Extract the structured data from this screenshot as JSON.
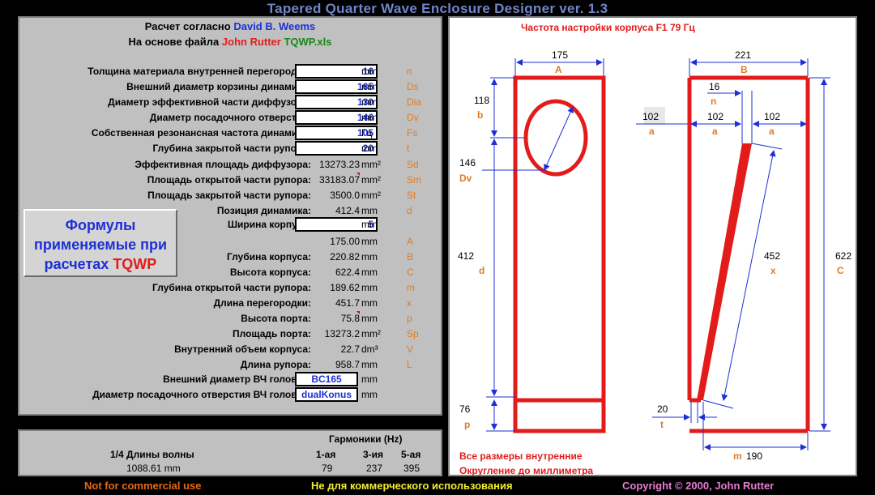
{
  "app_title": "Tapered Quarter Wave Enclosure Designer ver. 1.3",
  "header": {
    "line1_prefix": "Расчет согласно",
    "line1_name": "David B. Weems",
    "line2_prefix": "На основе файла",
    "line2_name": "John Rutter",
    "line2_file": "TQWP.xls"
  },
  "params": [
    {
      "label": "Толщина материала внутренней перегородки:",
      "value": "16",
      "unit": "mm",
      "symbol": "n",
      "input": true
    },
    {
      "label": "Внешний диаметр корзины динамика:",
      "value": "165",
      "unit": "mm",
      "symbol": "Ds",
      "input": true
    },
    {
      "label": "Диаметр эффективной части диффузора:",
      "value": "130",
      "unit": "mm",
      "symbol": "Dia",
      "input": true
    },
    {
      "label": "Диаметр посадочного отверстия:",
      "value": "146",
      "unit": "mm",
      "symbol": "Dv",
      "input": true
    },
    {
      "label": "Собственная резонансная частота динамика:",
      "value": "105",
      "unit": "Гц",
      "symbol": "Fs",
      "input": true
    },
    {
      "label": "Глубина закрытой части рупора:",
      "value": "20",
      "unit": "mm",
      "symbol": "t",
      "input": true
    },
    {
      "label": "Эффективная площадь диффузора:",
      "value": "13273.23",
      "unit": "mm²",
      "symbol": "Sd",
      "input": false
    },
    {
      "label": "Площадь открытой части рупора:",
      "value": "33183.07",
      "unit": "mm²",
      "symbol": "Sm",
      "input": false
    },
    {
      "label": "Площадь закрытой части рупора:",
      "value": "3500.0",
      "unit": "mm²",
      "symbol": "St",
      "input": false
    },
    {
      "label": "Позиция динамика:",
      "value": "412.4",
      "unit": "mm",
      "symbol": "d",
      "input": false
    },
    {
      "label": "Ширина корпуса:",
      "value": "5",
      "unit": "mm",
      "symbol": "",
      "input": true
    },
    {
      "label": "",
      "value": "175.00",
      "unit": "mm",
      "symbol": "A",
      "input": false
    },
    {
      "label": "Глубина корпуса:",
      "value": "220.82",
      "unit": "mm",
      "symbol": "B",
      "input": false
    },
    {
      "label": "Высота корпуса:",
      "value": "622.4",
      "unit": "mm",
      "symbol": "C",
      "input": false
    },
    {
      "label": "Глубина открытой части рупора:",
      "value": "189.62",
      "unit": "mm",
      "symbol": "m",
      "input": false
    },
    {
      "label": "Длина перегородки:",
      "value": "451.7",
      "unit": "mm",
      "symbol": "x",
      "input": false
    },
    {
      "label": "Высота порта:",
      "value": "75.8",
      "unit": "mm",
      "symbol": "p",
      "input": false
    },
    {
      "label": "Площадь порта:",
      "value": "13273.2",
      "unit": "mm²",
      "symbol": "Sp",
      "input": false
    },
    {
      "label": "Внутренний объем корпуса:",
      "value": "22.7",
      "unit": "dm³",
      "symbol": "V",
      "input": false
    },
    {
      "label": "Длина рупора:",
      "value": "958.7",
      "unit": "mm",
      "symbol": "L",
      "input": false
    },
    {
      "label": "Внешний диаметр ВЧ головки:",
      "value": "BC165",
      "unit": "mm",
      "symbol": "",
      "input": true
    },
    {
      "label": "Диаметр посадочного отверстия ВЧ головки:",
      "value": "dualKonus",
      "unit": "mm",
      "symbol": "",
      "input": true
    }
  ],
  "formulas_button": {
    "line1": "Формулы",
    "line2": "применяемые при",
    "line3_prefix": "расчетах",
    "line3_name": "TQWP"
  },
  "harmonics": {
    "title": "Гармоники (Hz)",
    "quarter_label": "1/4 Длины волны",
    "quarter_value": "1088.61 mm",
    "columns": [
      {
        "label": "1-ая",
        "value": "79"
      },
      {
        "label": "3-ия",
        "value": "237"
      },
      {
        "label": "5-ая",
        "value": "395"
      }
    ]
  },
  "diagram": {
    "title": "Частота настройки корпуса F1 79  Гц",
    "labels": {
      "A_val": "175",
      "A_sym": "A",
      "B_val": "221",
      "B_sym": "B",
      "b_val": "118",
      "b_sym": "b",
      "Dv_val": "146",
      "Dv_sym": "Dv",
      "d_val": "412",
      "d_sym": "d",
      "p_val": "76",
      "p_sym": "p",
      "n_val": "16",
      "n_sym": "n",
      "a1_val": "102",
      "a1_sym": "a",
      "a2_val": "102",
      "a2_sym": "a",
      "a3_val": "102",
      "a3_sym": "a",
      "x_val": "452",
      "x_sym": "x",
      "C_val": "622",
      "C_sym": "C",
      "t_val": "20",
      "t_sym": "t",
      "m_sym": "m",
      "m_val": "190"
    },
    "note1": "Все размеры внутренние",
    "note2": "Округление до миллиметра"
  },
  "footer": {
    "left": "Not for commercial use",
    "mid": "Не для коммерческого использования",
    "right": "Copyright © 2000, John Rutter"
  },
  "colors": {
    "accent_blue": "#1e2fd6",
    "accent_red": "#e31b1b",
    "symbol_orange": "#e07c26",
    "panel_gray": "#c0c0c0"
  }
}
